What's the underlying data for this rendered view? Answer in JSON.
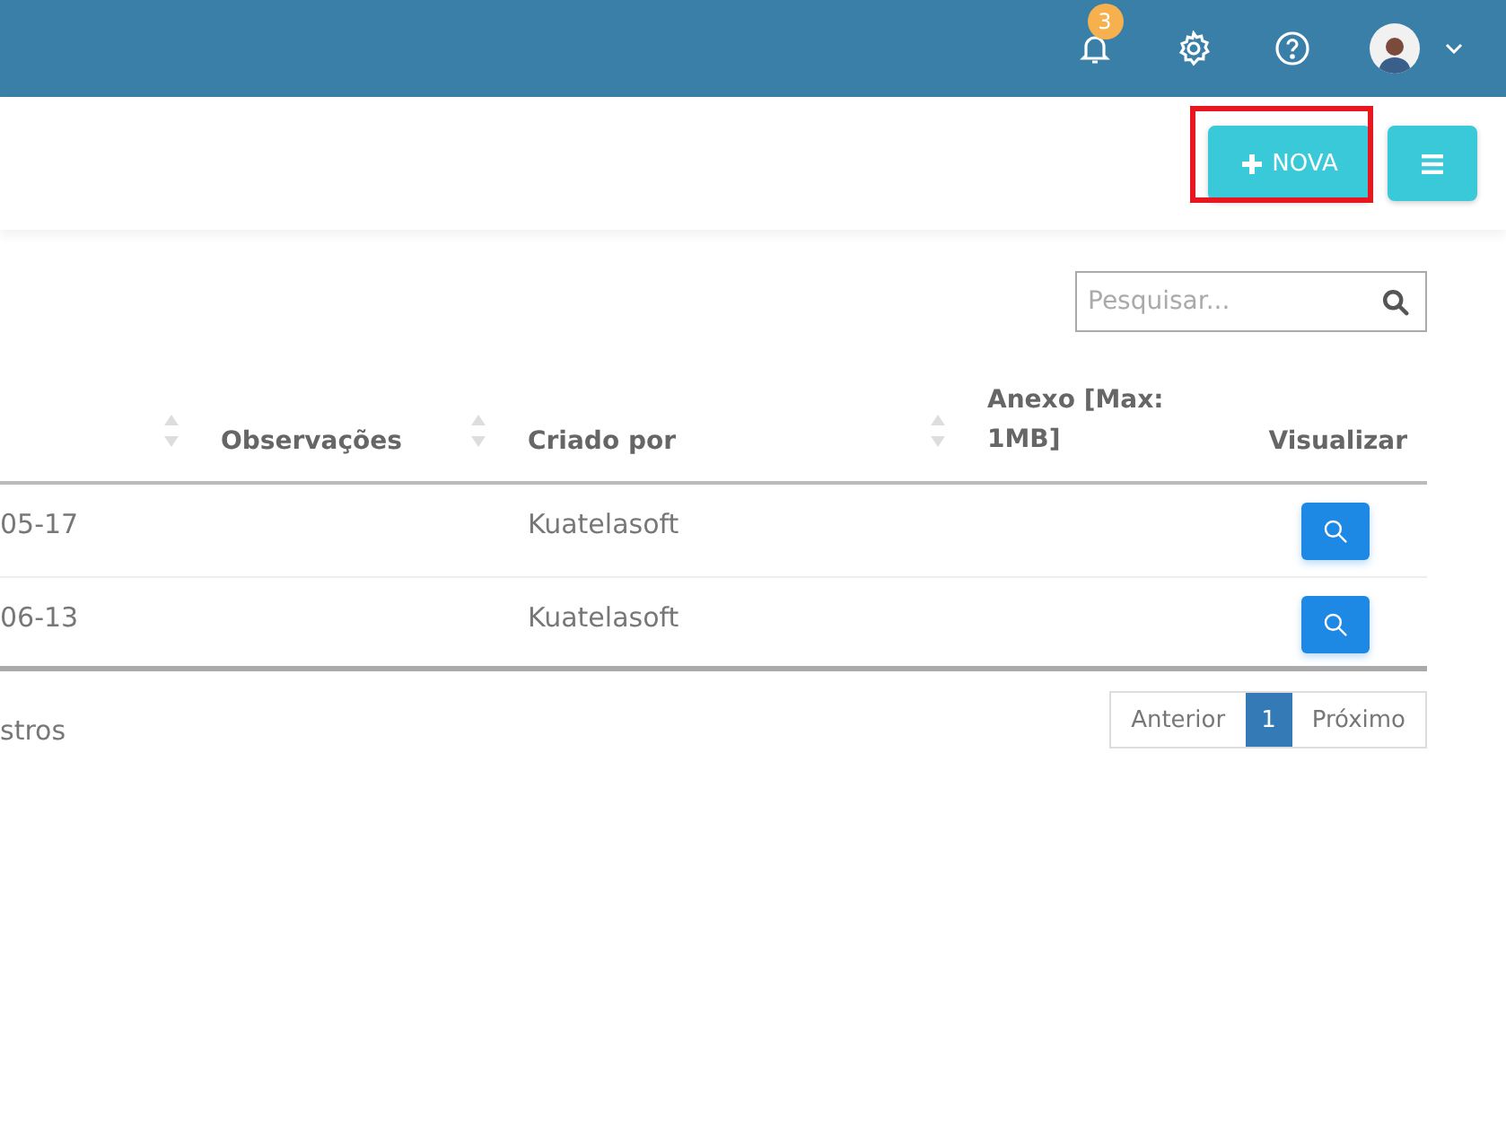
{
  "topbar": {
    "notifications_badge": "3"
  },
  "toolbar": {
    "new_button": "NOVA",
    "highlighted": true
  },
  "search": {
    "placeholder": "Pesquisar..."
  },
  "table": {
    "columns": [
      {
        "sortable": true
      },
      {
        "label": "Observações",
        "sortable": true
      },
      {
        "label": "Criado por",
        "sortable": true
      },
      {
        "label": "Anexo [Max: 1MB]",
        "sortable": false
      },
      {
        "label": "Visualizar",
        "sortable": false
      }
    ],
    "rows": [
      {
        "column_1": "05-17",
        "created_by": "Kuatelasoft"
      },
      {
        "column_1": "06-13",
        "created_by": "Kuatelasoft"
      }
    ]
  },
  "footer": {
    "info": "stros"
  },
  "pagination": {
    "previous": "Anterior",
    "next": "Próximo",
    "pages": [
      {
        "label": "1",
        "selected": true
      }
    ]
  }
}
